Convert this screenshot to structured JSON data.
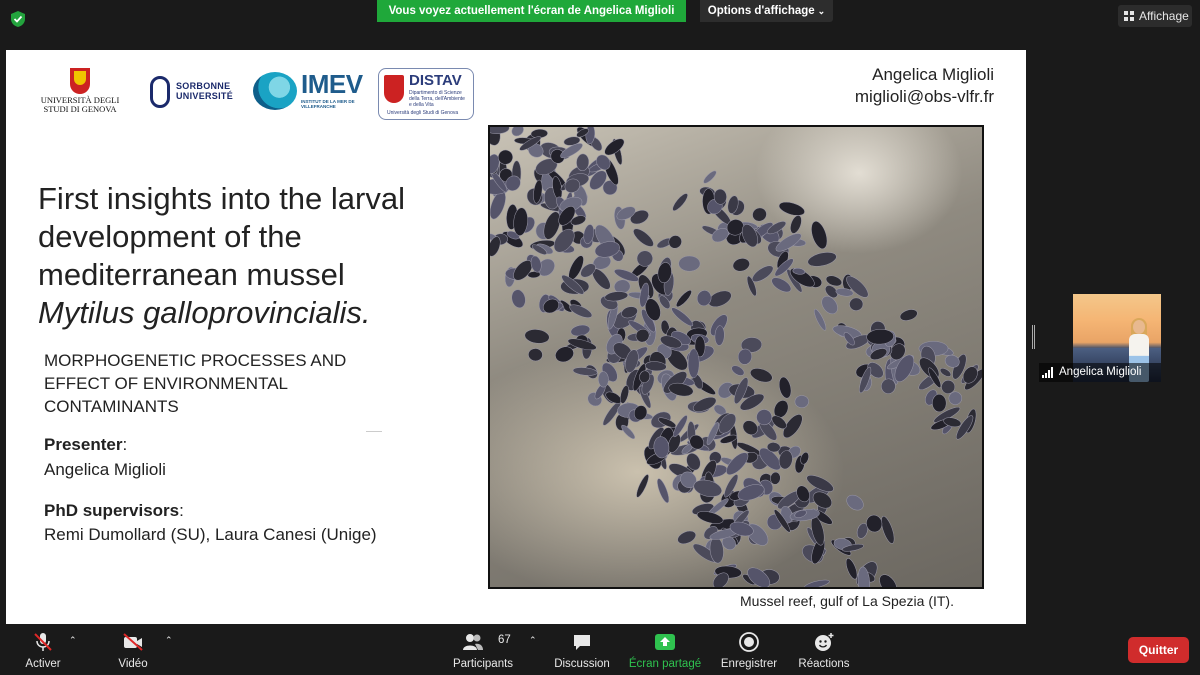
{
  "screen_share": {
    "banner": "Vous voyez actuellement l'écran de Angelica Miglioli",
    "view_options_label": "Options d'affichage",
    "view_button_label": "Affichage",
    "banner_color": "#1fa83a"
  },
  "slide": {
    "logos": {
      "genova_text": "UNIVERSITÀ DEGLI STUDI DI GENOVA",
      "sorbonne_text": "SORBONNE UNIVERSITÉ",
      "imev_text": "IMEV",
      "imev_sub": "INSTITUT DE LA MER DE VILLEFRANCHE",
      "distav_text": "DISTAV",
      "distav_sub": "Dipartimento di Scienze della Terra, dell'Ambiente e della Vita",
      "distav_footer": "Università degli Studi di Genova"
    },
    "author_name": "Angelica Miglioli",
    "author_email": "miglioli@obs-vlfr.fr",
    "title_main": "First insights into the larval development of the mediterranean mussel",
    "title_species": "Mytilus galloprovincialis.",
    "subtitle": "MORPHOGENETIC PROCESSES AND EFFECT OF ENVIRONMENTAL CONTAMINANTS",
    "presenter_label": "Presenter",
    "presenter_name": "Angelica Miglioli",
    "supervisors_label": "PhD supervisors",
    "supervisors_names": "Remi Dumollard (SU), Laura Canesi (Unige)",
    "photo_caption": "Mussel reef, gulf of La Spezia (IT)."
  },
  "participant_video": {
    "name": "Angelica Miglioli"
  },
  "toolbar": {
    "mute_label": "Activer",
    "video_label": "Vidéo",
    "participants_label": "Participants",
    "participants_count": "67",
    "chat_label": "Discussion",
    "share_label": "Écran partagé",
    "record_label": "Enregistrer",
    "reactions_label": "Réactions",
    "quit_label": "Quitter",
    "active_color": "#2fc24f",
    "quit_color": "#d02c2c"
  }
}
